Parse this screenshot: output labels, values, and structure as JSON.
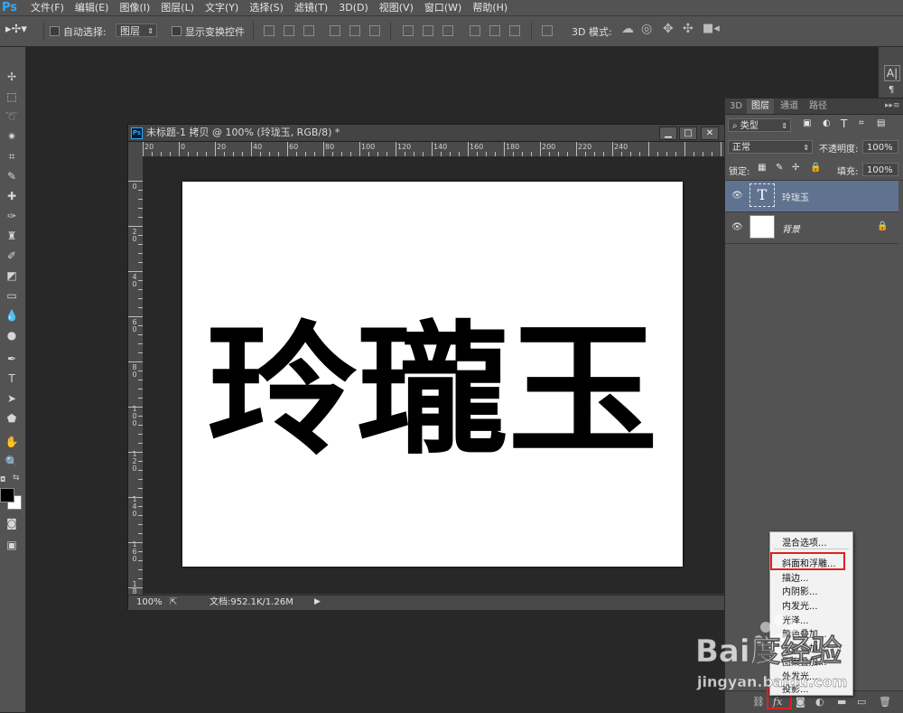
{
  "app": {
    "logo": "Ps"
  },
  "menu": [
    "文件(F)",
    "编辑(E)",
    "图像(I)",
    "图层(L)",
    "文字(Y)",
    "选择(S)",
    "滤镜(T)",
    "3D(D)",
    "视图(V)",
    "窗口(W)",
    "帮助(H)"
  ],
  "options": {
    "auto_select_label": "自动选择:",
    "auto_select_value": "图层",
    "show_transform_label": "显示变换控件",
    "mode3d_label": "3D 模式:"
  },
  "document": {
    "title": "未标题-1 拷贝 @ 100% (玲珑玉, RGB/8) *",
    "ruler_top": [
      "20",
      "0",
      "20",
      "40",
      "60",
      "80",
      "100",
      "120",
      "140",
      "160",
      "180",
      "200",
      "220",
      "240"
    ],
    "ruler_left": [
      "0",
      "20",
      "40",
      "60",
      "80",
      "100",
      "120",
      "140",
      "160",
      "18"
    ],
    "canvas_text": "玲瓏玉",
    "zoom": "100%",
    "doc_info": "文档:952.1K/1.26M"
  },
  "panel": {
    "tabs": [
      "3D",
      "图层",
      "通道",
      "路径"
    ],
    "filter_kind": "类型",
    "blend_mode": "正常",
    "opacity_label": "不透明度:",
    "opacity_value": "100%",
    "lock_label": "锁定:",
    "fill_label": "填充:",
    "fill_value": "100%",
    "layers": [
      {
        "name": "玲珑玉",
        "thumb": "T",
        "selected": true
      },
      {
        "name": "背景",
        "locked": true
      }
    ],
    "fx_label": "fx"
  },
  "context_menu": {
    "items": [
      "混合选项...",
      "斜面和浮雕...",
      "描边...",
      "内阴影...",
      "内发光...",
      "光泽...",
      "颜色叠加...",
      "渐变叠加...",
      "图案叠加...",
      "外发光...",
      "投影..."
    ],
    "highlighted": "斜面和浮雕..."
  },
  "watermark": {
    "brand": "Bai度经验",
    "url": "jingyan.baidu.com"
  },
  "colors": {
    "highlight": "#e02020",
    "selected_layer": "#5f7390"
  }
}
